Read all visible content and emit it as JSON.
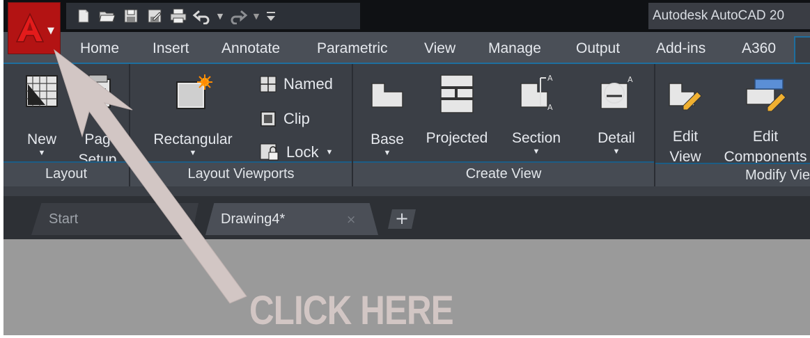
{
  "app": {
    "title": "Autodesk AutoCAD 20"
  },
  "ribbon_tabs": [
    "Home",
    "Insert",
    "Annotate",
    "Parametric",
    "View",
    "Manage",
    "Output",
    "Add-ins",
    "A360"
  ],
  "panels": {
    "layout": {
      "title": "Layout",
      "new_label": "New",
      "page_setup_line1": "Pag",
      "page_setup_line2": "Setup"
    },
    "layout_viewports": {
      "title": "Layout Viewports",
      "rectangular_label": "Rectangular",
      "named_label": "Named",
      "clip_label": "Clip",
      "lock_label": "Lock"
    },
    "create_view": {
      "title": "Create View",
      "base_label": "Base",
      "projected_label": "Projected",
      "section_label": "Section",
      "detail_label": "Detail"
    },
    "modify_view": {
      "title": "Modify Vie",
      "edit_view_line1": "Edit",
      "edit_view_line2": "View",
      "edit_components_line1": "Edit",
      "edit_components_line2": "Components"
    }
  },
  "file_tabs": {
    "start": "Start",
    "drawing": "Drawing4*",
    "close": "×",
    "new": "+"
  },
  "annotation": {
    "text": "CLICK HERE",
    "color": "#d2c6c4"
  },
  "icons": [
    "autocad-logo-icon",
    "new-file-icon",
    "open-folder-icon",
    "save-icon",
    "save-as-icon",
    "print-icon",
    "undo-icon",
    "redo-icon",
    "customize-dropdown-icon"
  ],
  "colors": {
    "app_button": "#b31313",
    "ribbon_bg": "#3b3f46",
    "accent_blue": "#1e6f9f",
    "canvas_bg": "#9a9a9a"
  }
}
